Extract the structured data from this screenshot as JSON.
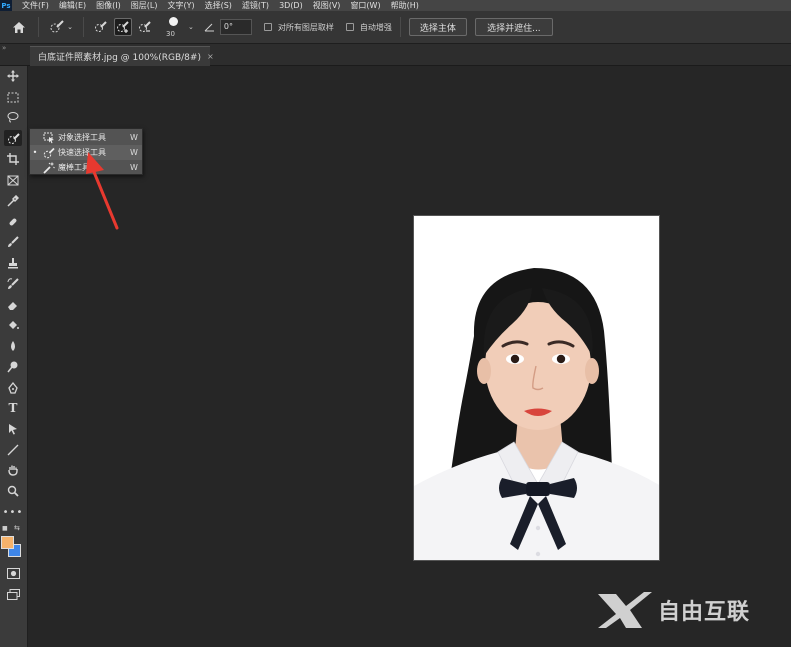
{
  "app": {
    "logo": "Ps"
  },
  "menubar": {
    "items": [
      "文件(F)",
      "编辑(E)",
      "图像(I)",
      "图层(L)",
      "文字(Y)",
      "选择(S)",
      "滤镜(T)",
      "3D(D)",
      "视图(V)",
      "窗口(W)",
      "帮助(H)"
    ]
  },
  "options": {
    "brush_size": "30",
    "angle": "0°",
    "sample_all_layers": "对所有图层取样",
    "auto_enhance": "自动增强",
    "select_subject": "选择主体",
    "select_and_mask": "选择并遮住..."
  },
  "document_tab": {
    "title": "白底证件照素材.jpg @ 100%(RGB/8#)",
    "close": "×"
  },
  "flyout": {
    "items": [
      {
        "label": "对象选择工具",
        "shortcut": "W",
        "icon": "object-select-icon",
        "selected": false
      },
      {
        "label": "快速选择工具",
        "shortcut": "W",
        "icon": "quick-select-icon",
        "selected": true
      },
      {
        "label": "魔棒工具",
        "shortcut": "W",
        "icon": "magic-wand-icon",
        "selected": false
      }
    ],
    "bullet": "•"
  },
  "colors": {
    "foreground": "#f5b26b",
    "background": "#3e86e8",
    "arrow": "#e8392f"
  },
  "watermark": {
    "text": "自由互联"
  }
}
